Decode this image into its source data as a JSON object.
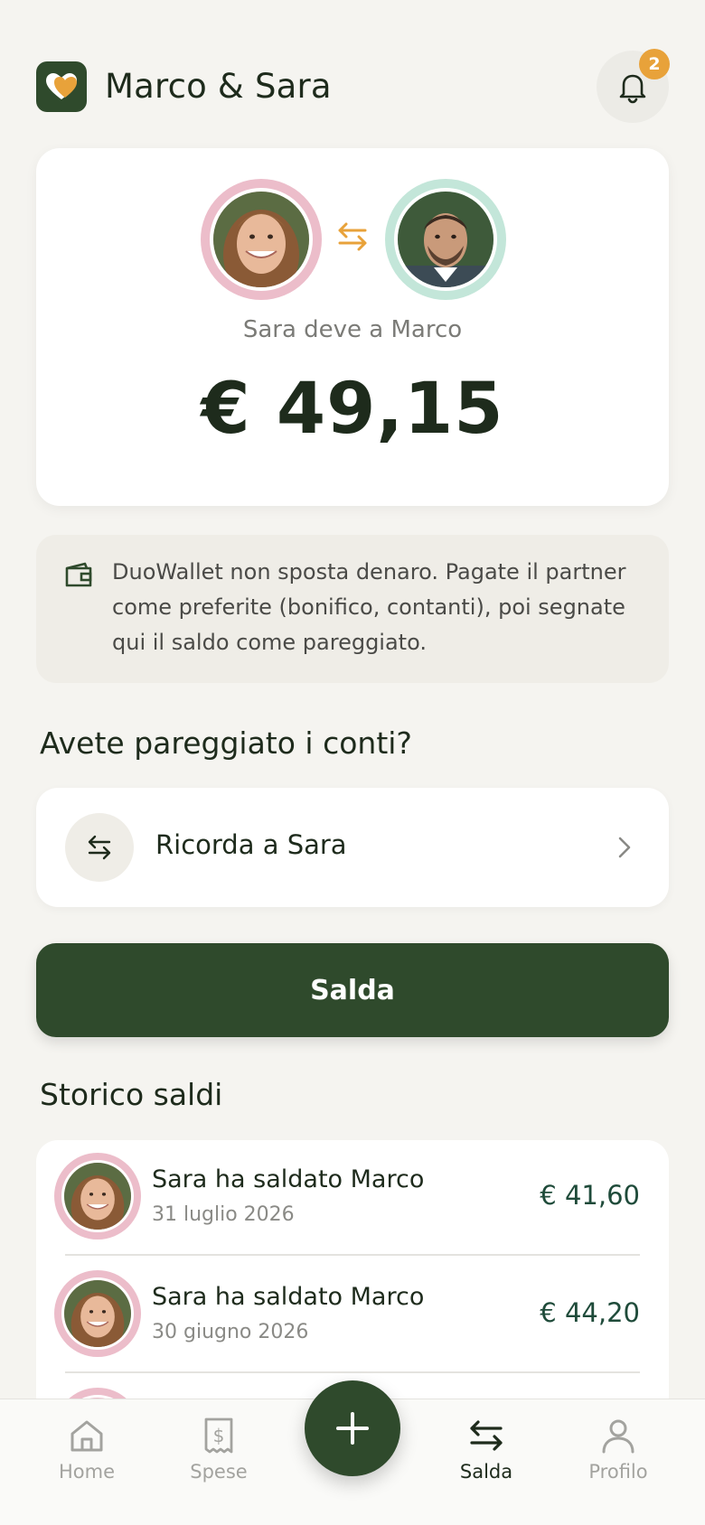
{
  "header": {
    "title": "Marco & Sara",
    "logo_icon": "heart-icon",
    "notifications": {
      "icon": "bell-icon",
      "count": "2"
    }
  },
  "balance": {
    "from_user": "Sara",
    "to_user": "Marco",
    "caption": "Sara deve a Marco",
    "amount": "€ 49,15",
    "swap_icon": "swap-arrows-icon"
  },
  "info": {
    "icon": "wallet-icon",
    "text": "DuoWallet non sposta denaro. Pagate il partner come preferite (bonifico, contanti), poi segnate qui il saldo come pareggiato."
  },
  "settle_section": {
    "title": "Avete pareggiato i conti?",
    "remind_label": "Ricorda a Sara",
    "settle_button": "Salda"
  },
  "history": {
    "title": "Storico saldi",
    "items": [
      {
        "title": "Sara ha saldato Marco",
        "date": "31 luglio 2026",
        "amount": "€ 41,60"
      },
      {
        "title": "Sara ha saldato Marco",
        "date": "30 giugno 2026",
        "amount": "€ 44,20"
      }
    ]
  },
  "nav": {
    "items": [
      {
        "label": "Home",
        "icon": "home-icon"
      },
      {
        "label": "Spese",
        "icon": "receipt-icon"
      },
      {
        "label": "Salda",
        "icon": "swap-arrows-icon",
        "active": true
      },
      {
        "label": "Profilo",
        "icon": "user-icon"
      }
    ],
    "fab_icon": "plus-icon"
  },
  "colors": {
    "background": "#f5f4f0",
    "primary": "#2f4a2c",
    "accent": "#e8a23a",
    "pink_ring": "#ecbdca",
    "mint_ring": "#c3e6d9"
  }
}
